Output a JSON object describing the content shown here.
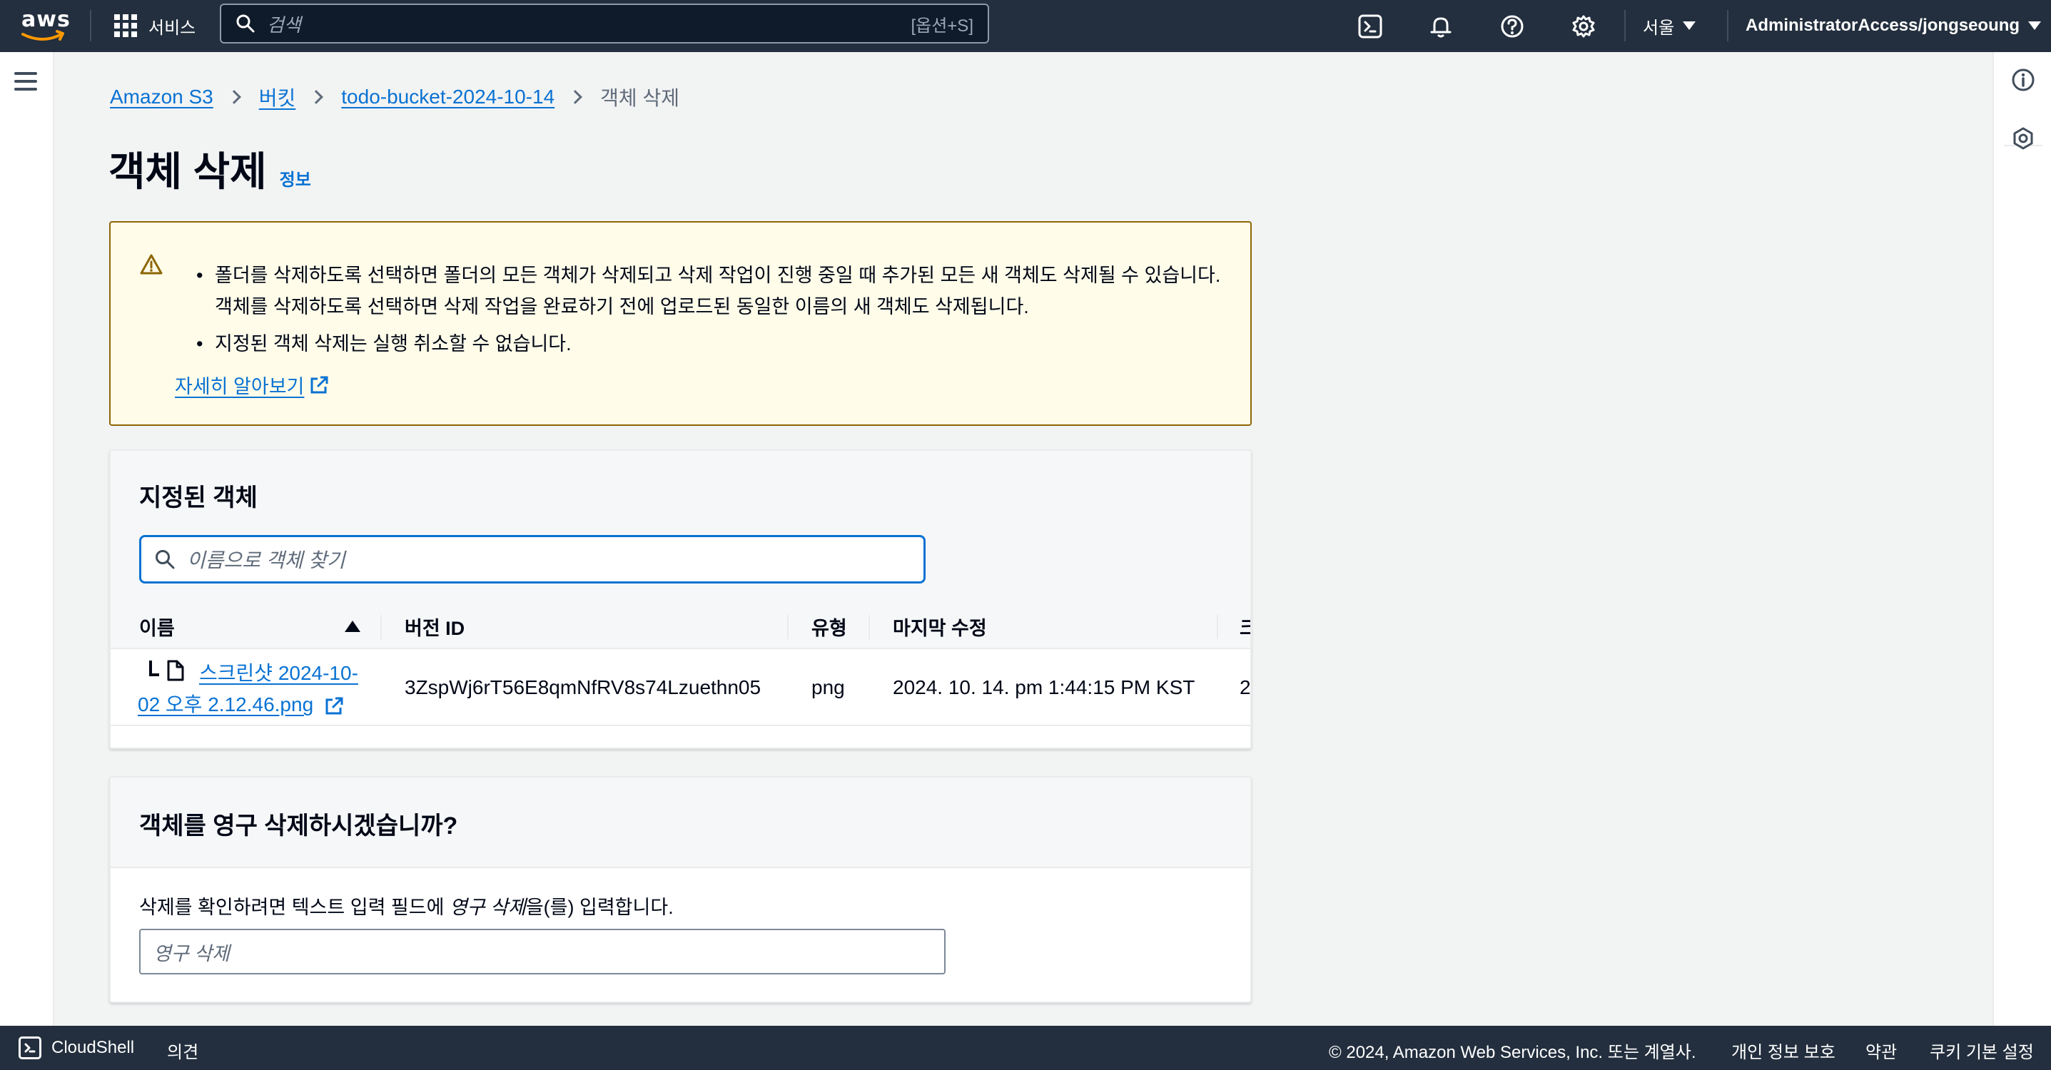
{
  "nav": {
    "logo": "aws",
    "services_label": "서비스",
    "search_placeholder": "검색",
    "search_shortcut": "[옵션+S]",
    "region": "서울",
    "account": "AdministratorAccess/jongseoung"
  },
  "breadcrumb": {
    "items": [
      "Amazon S3",
      "버킷",
      "todo-bucket-2024-10-14"
    ],
    "current": "객체 삭제"
  },
  "page": {
    "title": "객체 삭제",
    "info": "정보"
  },
  "alert": {
    "bullets": [
      "폴더를 삭제하도록 선택하면 폴더의 모든 객체가 삭제되고 삭제 작업이 진행 중일 때 추가된 모든 새 객체도 삭제될 수 있습니다. 객체를 삭제하도록 선택하면 삭제 작업을 완료하기 전에 업로드된 동일한 이름의 새 객체도 삭제됩니다.",
      "지정된 객체 삭제는 실행 취소할 수 없습니다."
    ],
    "learn_more": "자세히 알아보기"
  },
  "objects": {
    "title": "지정된 객체",
    "filter_placeholder": "이름으로 객체 찾기",
    "columns": [
      "이름",
      "버전 ID",
      "유형",
      "마지막 수정",
      "크"
    ],
    "rows": [
      {
        "name": "스크린샷 2024-10-02 오후 2.12.46.png",
        "version_id": "3ZspWj6rT56E8qmNfRV8s74Lzuethn05",
        "type": "png",
        "last_modified": "2024. 10. 14. pm 1:44:15 PM KST",
        "size": "2"
      }
    ]
  },
  "confirm": {
    "title": "객체를 영구 삭제하시겠습니까?",
    "label_before": "삭제를 확인하려면 텍스트 입력 필드에 ",
    "label_em": "영구 삭제",
    "label_after": "을(를) 입력합니다.",
    "placeholder": "영구 삭제"
  },
  "footer": {
    "cloudshell": "CloudShell",
    "feedback": "의견",
    "copyright": "© 2024, Amazon Web Services, Inc. 또는 계열사.",
    "privacy": "개인 정보 보호",
    "terms": "약관",
    "cookies": "쿠키 기본 설정"
  },
  "colors": {
    "nav_bg": "#232f3e",
    "link": "#0972d3",
    "warning_bg": "#fffce9",
    "warning_border": "#8d6605"
  }
}
